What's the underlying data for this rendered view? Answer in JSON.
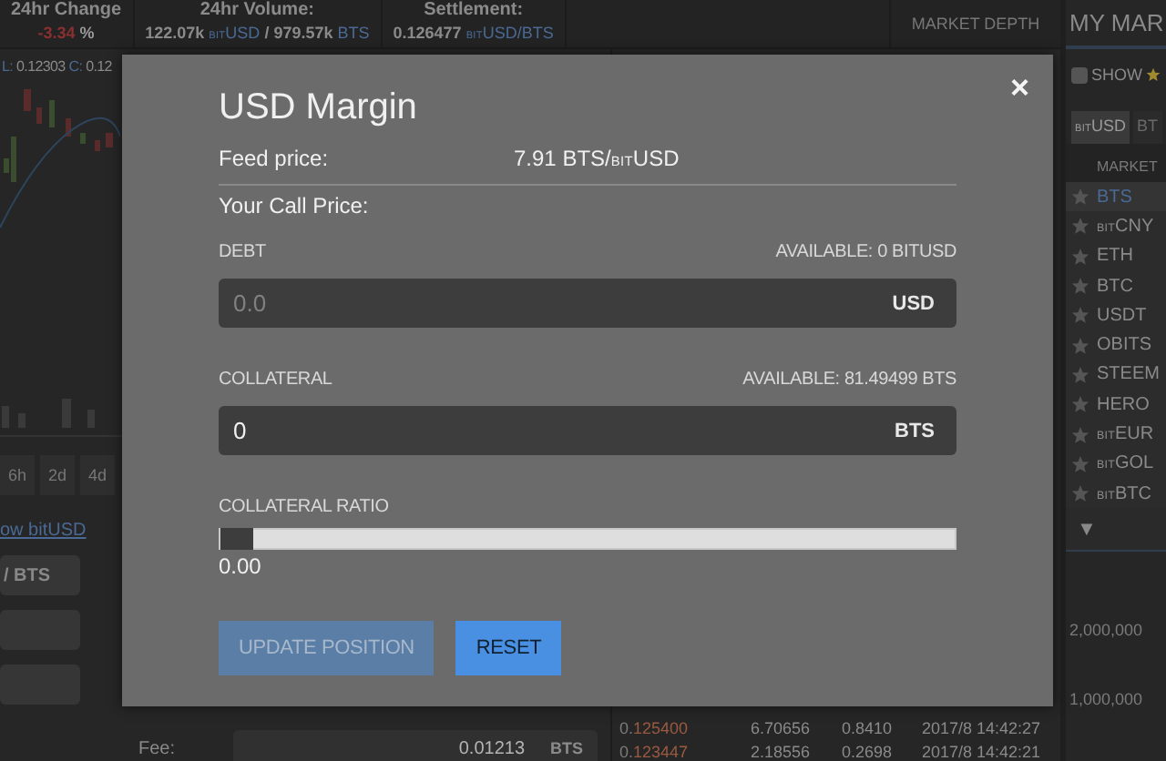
{
  "top_bar": {
    "stats": [
      {
        "label": "24hr Change",
        "parts": [
          {
            "text": "-3.34",
            "kind": "negative"
          },
          {
            "text": "%",
            "kind": "unit"
          }
        ]
      },
      {
        "label": "24hr Volume:",
        "parts": [
          {
            "text": "122.07k",
            "kind": "number"
          },
          {
            "text": "USD",
            "prefix": "BIT",
            "kind": "asset"
          },
          {
            "text": "/ 979.57k",
            "kind": "number"
          },
          {
            "text": "BTS",
            "kind": "asset"
          }
        ]
      },
      {
        "label": "Settlement:",
        "parts": [
          {
            "text": "0.126477",
            "kind": "number"
          },
          {
            "text": "USD/BTS",
            "prefix": "BIT",
            "kind": "asset"
          }
        ]
      }
    ],
    "depth_tab": "MARKET DEPTH"
  },
  "price_chart": {
    "legend": [
      {
        "key": "L:",
        "value": "0.12303"
      },
      {
        "key": "C:",
        "value": "0.12"
      }
    ],
    "periods": [
      "6h",
      "2d",
      "4d"
    ]
  },
  "order_form": {
    "link": "ow bitUSD",
    "pair": "/ BTS",
    "fee": {
      "label": "Fee:",
      "value": "0.01213",
      "asset": "BTS"
    }
  },
  "trade_history": [
    {
      "kind": "sell",
      "price_lead": "0.",
      "price": "125400",
      "amount": "6.70656",
      "total": "0.8410",
      "time": "2017/8 14:42:27"
    },
    {
      "kind": "sell",
      "price_lead": "0.",
      "price": "123447",
      "amount": "2.18556",
      "total": "0.2698",
      "time": "2017/8 14:42:21"
    }
  ],
  "markets_panel": {
    "title": "MY MAR",
    "show_starred": {
      "label": "SHOW",
      "checked": false
    },
    "tabs": [
      {
        "prefix": "BIT",
        "name": "USD",
        "selected": true
      },
      {
        "name": "BT",
        "selected": false
      }
    ],
    "column": "MARKET",
    "markets": [
      {
        "name": "BTS",
        "selected": true
      },
      {
        "prefix": "BIT",
        "name": "CNY",
        "selected": false
      },
      {
        "name": "ETH",
        "selected": false
      },
      {
        "name": "BTC",
        "selected": false
      },
      {
        "name": "USDT",
        "selected": false
      },
      {
        "name": "OBITS",
        "selected": false
      },
      {
        "name": "STEEM",
        "selected": false
      },
      {
        "name": "HERO",
        "selected": false
      },
      {
        "prefix": "BIT",
        "name": "EUR",
        "selected": false
      },
      {
        "prefix": "BIT",
        "name": "GOL",
        "selected": false
      },
      {
        "prefix": "BIT",
        "name": "BTC",
        "selected": false
      }
    ],
    "collapse": "▼",
    "depth_axis": [
      "2,000,000",
      "1,000,000"
    ]
  },
  "dialog": {
    "title": "USD Margin",
    "close": "×",
    "feed_price": {
      "label": "Feed price:",
      "value": "7.91 BTS/",
      "prefix": "BIT",
      "asset": "USD"
    },
    "call_price": {
      "label": "Your Call Price:"
    },
    "fields": [
      {
        "label": "DEBT",
        "available": "AVAILABLE: 0 BITUSD",
        "placeholder": "0.0",
        "unit": "USD"
      },
      {
        "label": "COLLATERAL",
        "available": "AVAILABLE: 81.49499 BTS",
        "value": "0",
        "unit": "BTS"
      }
    ],
    "ratio": {
      "label": "COLLATERAL RATIO",
      "level": 0,
      "reading": "0.00"
    },
    "buttons": [
      {
        "label": "UPDATE POSITION",
        "disabled": true
      },
      {
        "label": "RESET",
        "disabled": false
      }
    ]
  }
}
